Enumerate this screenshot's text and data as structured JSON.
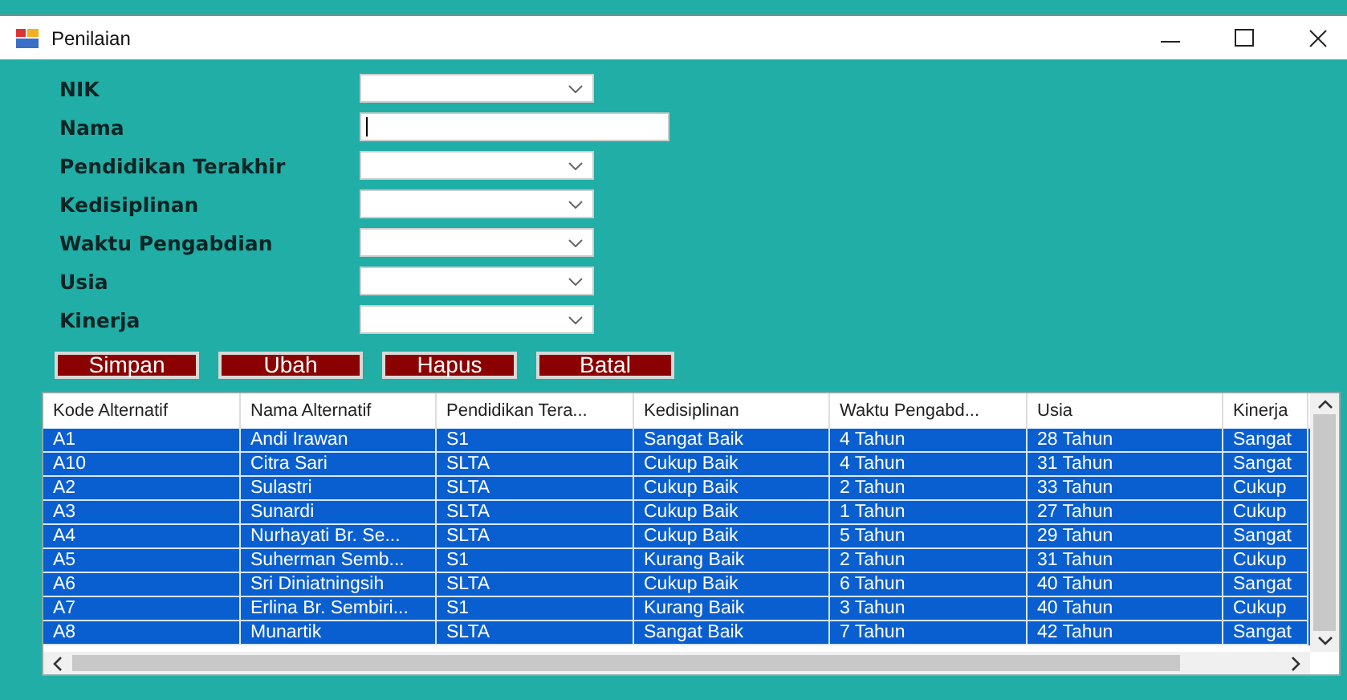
{
  "window": {
    "title": "Penilaian"
  },
  "form": [
    {
      "label": "NIK",
      "kind": "combo"
    },
    {
      "label": "Nama",
      "kind": "text"
    },
    {
      "label": "Pendidikan Terakhir",
      "kind": "combo"
    },
    {
      "label": "Kedisiplinan",
      "kind": "combo"
    },
    {
      "label": "Waktu Pengabdian",
      "kind": "combo"
    },
    {
      "label": "Usia",
      "kind": "combo"
    },
    {
      "label": "Kinerja",
      "kind": "combo"
    }
  ],
  "buttons": [
    "Simpan",
    "Ubah",
    "Hapus",
    "Batal"
  ],
  "table": {
    "columns": [
      "Kode Alternatif",
      "Nama Alternatif",
      "Pendidikan Tera...",
      "Kedisiplinan",
      "Waktu Pengabd...",
      "Usia",
      "Kinerja"
    ],
    "rows": [
      {
        "selected": true,
        "cells": [
          "A1",
          "Andi Irawan",
          "S1",
          "Sangat Baik",
          "4 Tahun",
          "28 Tahun",
          "Sangat"
        ]
      },
      {
        "selected": true,
        "cells": [
          "A10",
          "Citra Sari",
          "SLTA",
          "Cukup Baik",
          "4 Tahun",
          "31 Tahun",
          "Sangat"
        ]
      },
      {
        "selected": true,
        "cells": [
          "A2",
          "Sulastri",
          "SLTA",
          "Cukup Baik",
          "2 Tahun",
          "33 Tahun",
          "Cukup"
        ]
      },
      {
        "selected": true,
        "cells": [
          "A3",
          "Sunardi",
          "SLTA",
          "Cukup Baik",
          "1 Tahun",
          "27 Tahun",
          "Cukup"
        ]
      },
      {
        "selected": true,
        "cells": [
          "A4",
          "Nurhayati Br. Se...",
          "SLTA",
          "Cukup Baik",
          "5 Tahun",
          "29 Tahun",
          "Sangat"
        ]
      },
      {
        "selected": true,
        "cells": [
          "A5",
          "Suherman Semb...",
          "S1",
          "Kurang Baik",
          "2 Tahun",
          "31 Tahun",
          "Cukup"
        ]
      },
      {
        "selected": true,
        "cells": [
          "A6",
          "Sri Diniatningsih",
          "SLTA",
          "Cukup Baik",
          "6 Tahun",
          "40 Tahun",
          "Sangat"
        ]
      },
      {
        "selected": true,
        "cells": [
          "A7",
          "Erlina Br. Sembiri...",
          "S1",
          "Kurang Baik",
          "3 Tahun",
          "40 Tahun",
          "Cukup"
        ]
      },
      {
        "selected": true,
        "cells": [
          "A8",
          "Munartik",
          "SLTA",
          "Sangat Baik",
          "7 Tahun",
          "42 Tahun",
          "Sangat"
        ]
      }
    ]
  }
}
